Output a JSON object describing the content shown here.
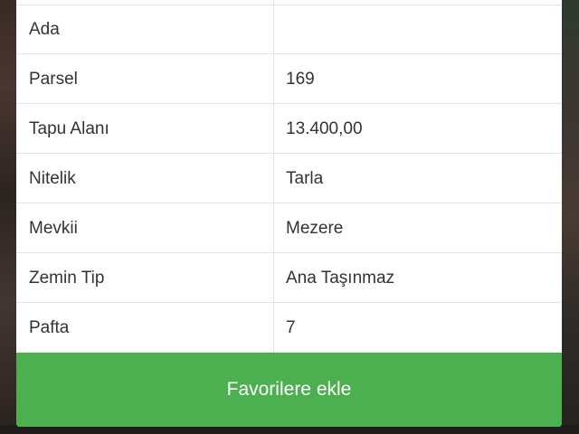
{
  "rows": [
    {
      "label": "Ada",
      "value": ""
    },
    {
      "label": "Parsel",
      "value": "169"
    },
    {
      "label": "Tapu Alanı",
      "value": "13.400,00"
    },
    {
      "label": "Nitelik",
      "value": "Tarla"
    },
    {
      "label": "Mevkii",
      "value": "Mezere"
    },
    {
      "label": "Zemin Tip",
      "value": "Ana Taşınmaz"
    },
    {
      "label": "Pafta",
      "value": "7"
    }
  ],
  "button": {
    "label": "Favorilere ekle"
  },
  "colors": {
    "button_bg": "#4caf50",
    "text": "#333333",
    "border": "#e3e3e3"
  }
}
